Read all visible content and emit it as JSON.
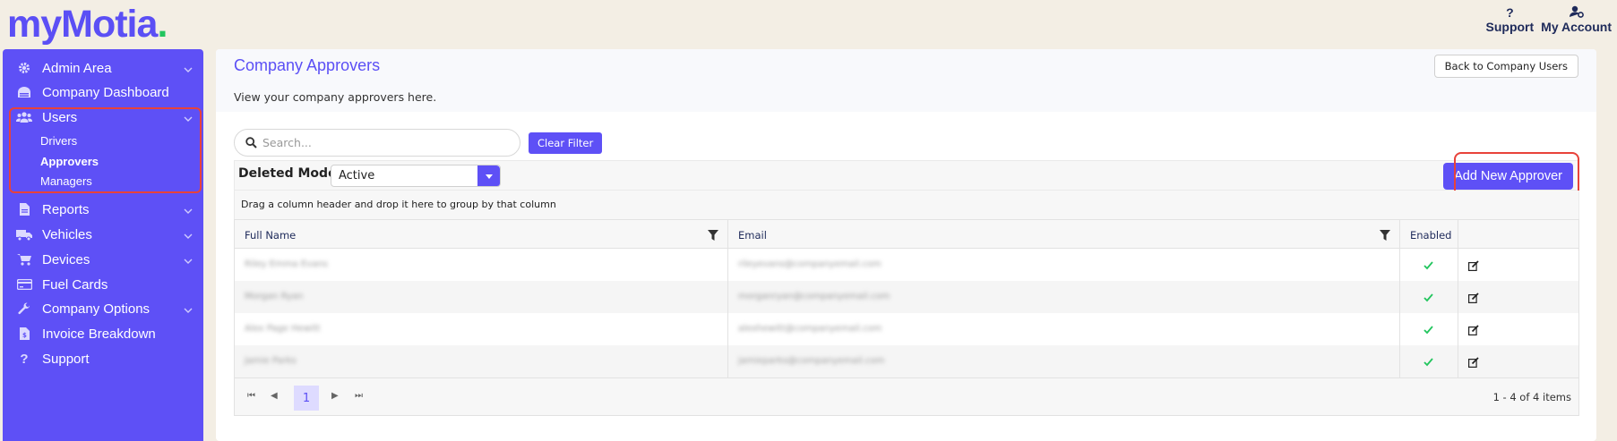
{
  "brand": {
    "name_part1": "my",
    "name_part2": "Motia",
    "dot": ".",
    "primary_color": "#5e50f6",
    "accent_color": "#22c55e"
  },
  "header": {
    "support": {
      "label": "Support",
      "icon": "question-icon"
    },
    "account": {
      "label": "My Account",
      "icon": "user-gear-icon"
    }
  },
  "sidebar": {
    "items": [
      {
        "label": "Admin Area",
        "icon": "gear-icon",
        "has_chevron": true
      },
      {
        "label": "Company Dashboard",
        "icon": "dashboard-icon",
        "has_chevron": false
      },
      {
        "label": "Users",
        "icon": "users-icon",
        "has_chevron": true
      },
      {
        "label": "Reports",
        "icon": "file-icon",
        "has_chevron": true
      },
      {
        "label": "Vehicles",
        "icon": "truck-icon",
        "has_chevron": true
      },
      {
        "label": "Devices",
        "icon": "cart-icon",
        "has_chevron": true
      },
      {
        "label": "Fuel Cards",
        "icon": "credit-card-icon",
        "has_chevron": false
      },
      {
        "label": "Company Options",
        "icon": "wrench-icon",
        "has_chevron": true
      },
      {
        "label": "Invoice Breakdown",
        "icon": "invoice-icon",
        "has_chevron": false
      },
      {
        "label": "Support",
        "icon": "question-icon",
        "has_chevron": false
      }
    ],
    "users_sub": [
      {
        "label": "Drivers",
        "active": false
      },
      {
        "label": "Approvers",
        "active": true
      },
      {
        "label": "Managers",
        "active": false
      }
    ]
  },
  "main": {
    "title": "Company Approvers",
    "subtitle": "View your company approvers here.",
    "back_button": "Back to Company Users",
    "search_placeholder": "Search...",
    "clear_filter": "Clear Filter",
    "deleted_mode_label": "Deleted Mode:",
    "deleted_mode_value": "Active",
    "add_button": "Add New Approver",
    "group_hint": "Drag a column header and drop it here to group by that column"
  },
  "grid": {
    "columns": [
      "Full Name",
      "Email",
      "Enabled"
    ],
    "rows": [
      {
        "name": "Riley Emma Evans",
        "email": "rileyevans@companyemail.com",
        "enabled": true
      },
      {
        "name": "Morgan Ryan",
        "email": "morganryan@companyemail.com",
        "enabled": true
      },
      {
        "name": "Alex Page Hewitt",
        "email": "alexhewitt@companyemail.com",
        "enabled": true
      },
      {
        "name": "Jamie Parks",
        "email": "jamieparks@companyemail.com",
        "enabled": true
      }
    ],
    "pager": {
      "current_page": "1",
      "info": "1 - 4 of 4 items"
    }
  }
}
